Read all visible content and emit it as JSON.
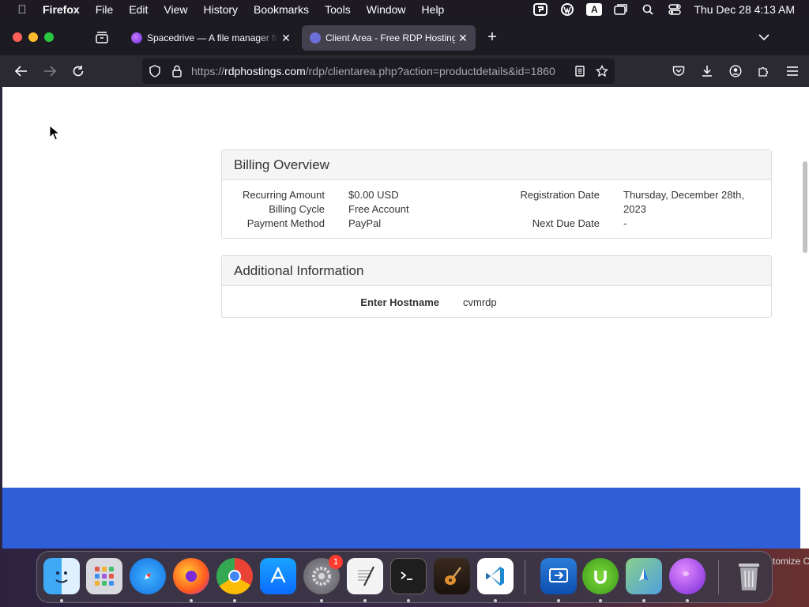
{
  "menubar": {
    "app_name": "Firefox",
    "items": [
      "File",
      "Edit",
      "View",
      "History",
      "Bookmarks",
      "Tools",
      "Window",
      "Help"
    ],
    "status_text_icon": "A",
    "clock": "Thu Dec 28  4:13 AM"
  },
  "tabs": [
    {
      "title": "Spacedrive — A file manager from the future.",
      "icon": "spacedrive-favicon"
    },
    {
      "title": "Client Area - Free RDP Hosting",
      "icon": "rdp-favicon"
    }
  ],
  "urlbar": {
    "prefix": "https://",
    "host": "rdphostings.com",
    "path": "/rdp/clientarea.php?action=productdetails&id=1860"
  },
  "billing": {
    "title": "Billing Overview",
    "recurring_amount_label": "Recurring Amount",
    "recurring_amount_value": "$0.00 USD",
    "billing_cycle_label": "Billing Cycle",
    "billing_cycle_value": "Free Account",
    "payment_method_label": "Payment Method",
    "payment_method_value": "PayPal",
    "registration_date_label": "Registration Date",
    "registration_date_value_line1": "Thursday, December 28th,",
    "registration_date_value_line2": "2023",
    "next_due_date_label": "Next Due Date",
    "next_due_date_value": "-"
  },
  "additional": {
    "title": "Additional Information",
    "hostname_label": "Enter Hostname",
    "hostname_value": "cvmrdp"
  },
  "dock": {
    "settings_badge": "1",
    "desktop_text": "tomize C"
  },
  "colors": {
    "footer_band": "#2f5fd8",
    "active_tab": "#42414d",
    "card_header": "#f5f5f5"
  }
}
